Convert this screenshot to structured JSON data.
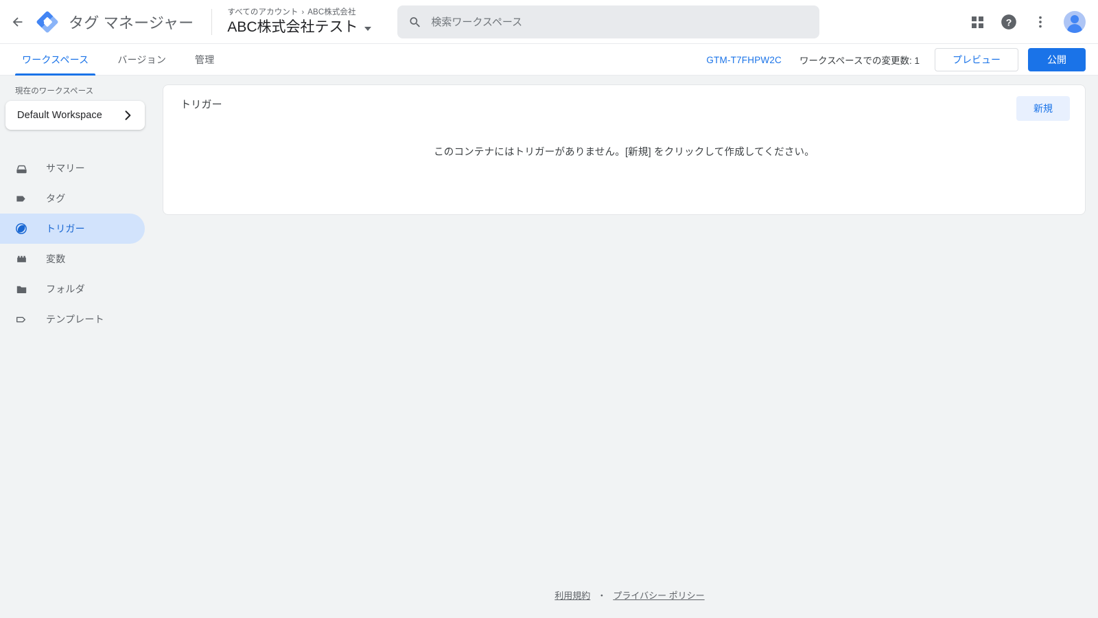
{
  "topbar": {
    "back_icon": "arrow-back-icon",
    "logo_icon": "gtm-logo-icon",
    "brand_title": "タグ マネージャー",
    "breadcrumb_root": "すべてのアカウント",
    "breadcrumb_sep": "›",
    "breadcrumb_account": "ABC株式会社",
    "container_name": "ABC株式会社テスト",
    "search": {
      "icon": "search-icon",
      "placeholder": "検索ワークスペース",
      "value": ""
    },
    "apps_icon": "apps-grid-icon",
    "help_icon": "help-circle-icon",
    "more_icon": "more-vert-icon",
    "avatar_icon": "user-avatar-icon"
  },
  "tabs": [
    {
      "label": "ワークスペース",
      "active": true
    },
    {
      "label": "バージョン",
      "active": false
    },
    {
      "label": "管理",
      "active": false
    }
  ],
  "tabbar_right": {
    "container_id": "GTM-T7FHPW2C",
    "changes_text": "ワークスペースでの変更数: 1",
    "preview_label": "プレビュー",
    "publish_label": "公開"
  },
  "sidebar": {
    "workspace_label": "現在のワークスペース",
    "workspace_name": "Default Workspace",
    "workspace_chevron_icon": "chevron-right-icon",
    "items": [
      {
        "label": "サマリー",
        "icon": "summary-box-icon",
        "active": false
      },
      {
        "label": "タグ",
        "icon": "tag-icon",
        "active": false
      },
      {
        "label": "トリガー",
        "icon": "trigger-icon",
        "active": true
      },
      {
        "label": "変数",
        "icon": "variable-brick-icon",
        "active": false
      },
      {
        "label": "フォルダ",
        "icon": "folder-icon",
        "active": false
      },
      {
        "label": "テンプレート",
        "icon": "template-outline-icon",
        "active": false
      }
    ]
  },
  "main": {
    "card_title": "トリガー",
    "new_button_label": "新規",
    "empty_message": "このコンテナにはトリガーがありません。[新規] をクリックして作成してください。"
  },
  "footer": {
    "terms_label": "利用規約",
    "separator": "・",
    "privacy_label": "プライバシー ポリシー"
  },
  "colors": {
    "accent_blue": "#1a73e8",
    "active_nav_bg": "#d2e3fc",
    "active_nav_text": "#1967d2",
    "new_button_bg": "#e8f0fe",
    "page_bg": "#f1f3f4",
    "card_bg": "#ffffff",
    "muted_text": "#5f6368"
  }
}
